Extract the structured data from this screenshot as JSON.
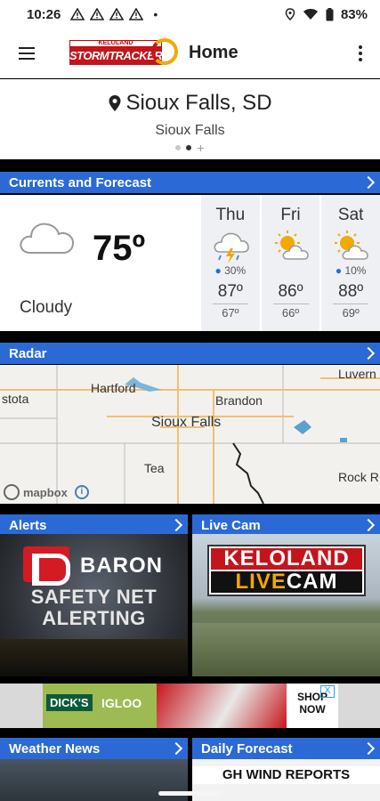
{
  "status_bar": {
    "time": "10:26",
    "battery": "83%"
  },
  "app_bar": {
    "logo_small": "KELOLAND",
    "logo_text": "STORMTRACKER",
    "title": "Home"
  },
  "location": {
    "main": "Sioux Falls, SD",
    "sub": "Sioux Falls"
  },
  "currents": {
    "header": "Currents and Forecast",
    "temperature": "75º",
    "condition": "Cloudy",
    "days": [
      {
        "name": "Thu",
        "icon": "thunderstorm-icon",
        "precip": "30%",
        "high": "87º",
        "low": "67º"
      },
      {
        "name": "Fri",
        "icon": "partly-sunny-icon",
        "precip": "",
        "high": "86º",
        "low": "66º"
      },
      {
        "name": "Sat",
        "icon": "partly-sunny-icon",
        "precip": "10%",
        "high": "88º",
        "low": "69º"
      }
    ]
  },
  "radar": {
    "header": "Radar",
    "labels": {
      "stota": "stota",
      "hartford": "Hartford",
      "brandon": "Brandon",
      "luverne": "Luvern",
      "sioux_falls": "Sioux Falls",
      "tea": "Tea",
      "rock_rapids": "Rock R"
    },
    "attribution": "mapbox"
  },
  "alerts": {
    "header": "Alerts",
    "brand": "BARON",
    "line1": "SAFETY NET",
    "line2": "ALERTING"
  },
  "live_cam": {
    "header": "Live Cam",
    "line1": "KELOLAND",
    "live": "LIVE",
    "cam": "CAM"
  },
  "ad": {
    "brand": "DICK'S",
    "product": "IGLOO",
    "cta_line1": "SHOP",
    "cta_line2": "NOW",
    "close": "X"
  },
  "weather_news": {
    "header": "Weather News"
  },
  "daily_forecast": {
    "header": "Daily Forecast",
    "caption": "GH WIND REPORTS"
  },
  "colors": {
    "header_blue": "#2b6ad6",
    "brand_red": "#c4151c",
    "accent_gold": "#f2a900"
  }
}
